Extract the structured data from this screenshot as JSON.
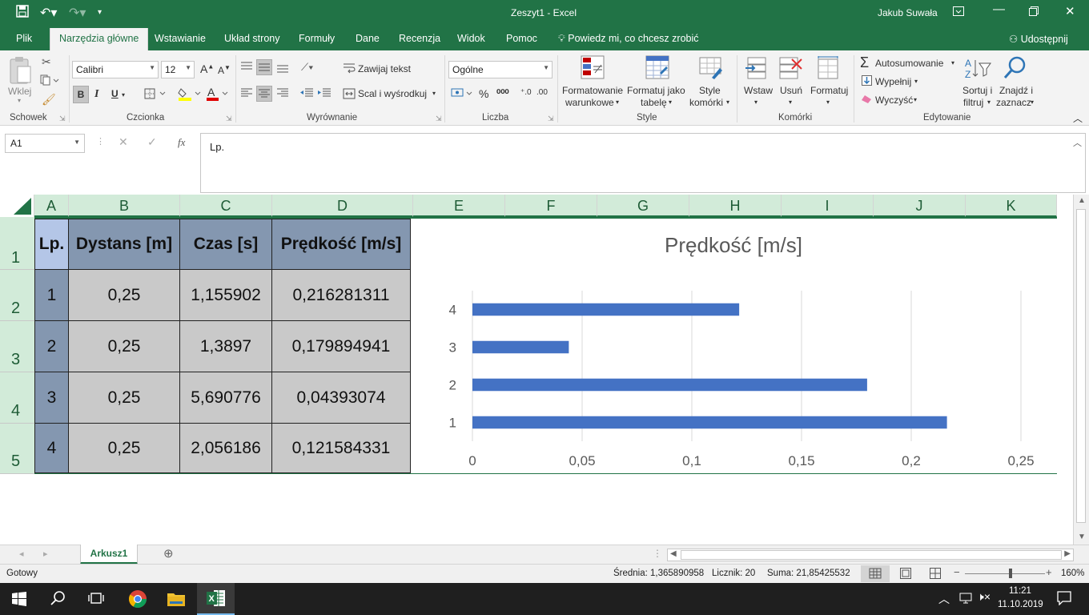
{
  "titlebar": {
    "doc_title": "Zeszyt1  -  Excel",
    "user": "Jakub Suwała"
  },
  "tabs": [
    "Plik",
    "Narzędzia główne",
    "Wstawianie",
    "Układ strony",
    "Formuły",
    "Dane",
    "Recenzja",
    "Widok",
    "Pomoc"
  ],
  "tell_me": "Powiedz mi, co chcesz zrobić",
  "share": "Udostępnij",
  "ribbon": {
    "clipboard": {
      "paste": "Wklej",
      "label": "Schowek"
    },
    "font": {
      "name": "Calibri",
      "size": "12",
      "bold": "B",
      "italic": "I",
      "underline": "U",
      "label": "Czcionka"
    },
    "alignment": {
      "wrap": "Zawijaj tekst",
      "merge": "Scal i wyśrodkuj",
      "label": "Wyrównanie"
    },
    "number": {
      "format": "Ogólne",
      "percent": "%",
      "label": "Liczba"
    },
    "styles": {
      "cond": [
        "Formatowanie",
        "warunkowe"
      ],
      "table": [
        "Formatuj jako",
        "tabelę"
      ],
      "cell": [
        "Style",
        "komórki"
      ],
      "label": "Style"
    },
    "cells": {
      "insert": "Wstaw",
      "delete": "Usuń",
      "format": "Formatuj",
      "label": "Komórki"
    },
    "editing": {
      "autosum": "Autosumowanie",
      "fill": "Wypełnij",
      "clear": "Wyczyść",
      "sort": [
        "Sortuj i",
        "filtruj"
      ],
      "find": [
        "Znajdź i",
        "zaznacz"
      ],
      "label": "Edytowanie"
    }
  },
  "formula": {
    "name_box": "A1",
    "fx": "fx",
    "content": "Lp."
  },
  "columns": [
    "A",
    "B",
    "C",
    "D",
    "E",
    "F",
    "G",
    "H",
    "I",
    "J",
    "K"
  ],
  "rows": [
    "1",
    "2",
    "3",
    "4",
    "5"
  ],
  "table": {
    "headers": [
      "Lp.",
      "Dystans [m]",
      "Czas [s]",
      "Prędkość [m/s]"
    ],
    "rows": [
      [
        "1",
        "0,25",
        "1,155902",
        "0,216281311"
      ],
      [
        "2",
        "0,25",
        "1,3897",
        "0,179894941"
      ],
      [
        "3",
        "0,25",
        "5,690776",
        "0,04393074"
      ],
      [
        "4",
        "0,25",
        "2,056186",
        "0,121584331"
      ]
    ]
  },
  "chart_data": {
    "type": "bar",
    "orientation": "horizontal",
    "title": "Prędkość [m/s]",
    "categories": [
      "1",
      "2",
      "3",
      "4"
    ],
    "values": [
      0.216281311,
      0.179894941,
      0.04393074,
      0.121584331
    ],
    "xlim": [
      0,
      0.25
    ],
    "ticks": [
      "0",
      "0,05",
      "0,1",
      "0,15",
      "0,2",
      "0,25"
    ],
    "color": "#4472c4",
    "grid": true
  },
  "sheet": {
    "name": "Arkusz1"
  },
  "status": {
    "ready": "Gotowy",
    "average": "Średnia: 1,365890958",
    "count": "Licznik: 20",
    "sum": "Suma: 21,85425532",
    "zoom": "160%"
  },
  "taskbar": {
    "time": "11:21",
    "date": "11.10.2019"
  }
}
